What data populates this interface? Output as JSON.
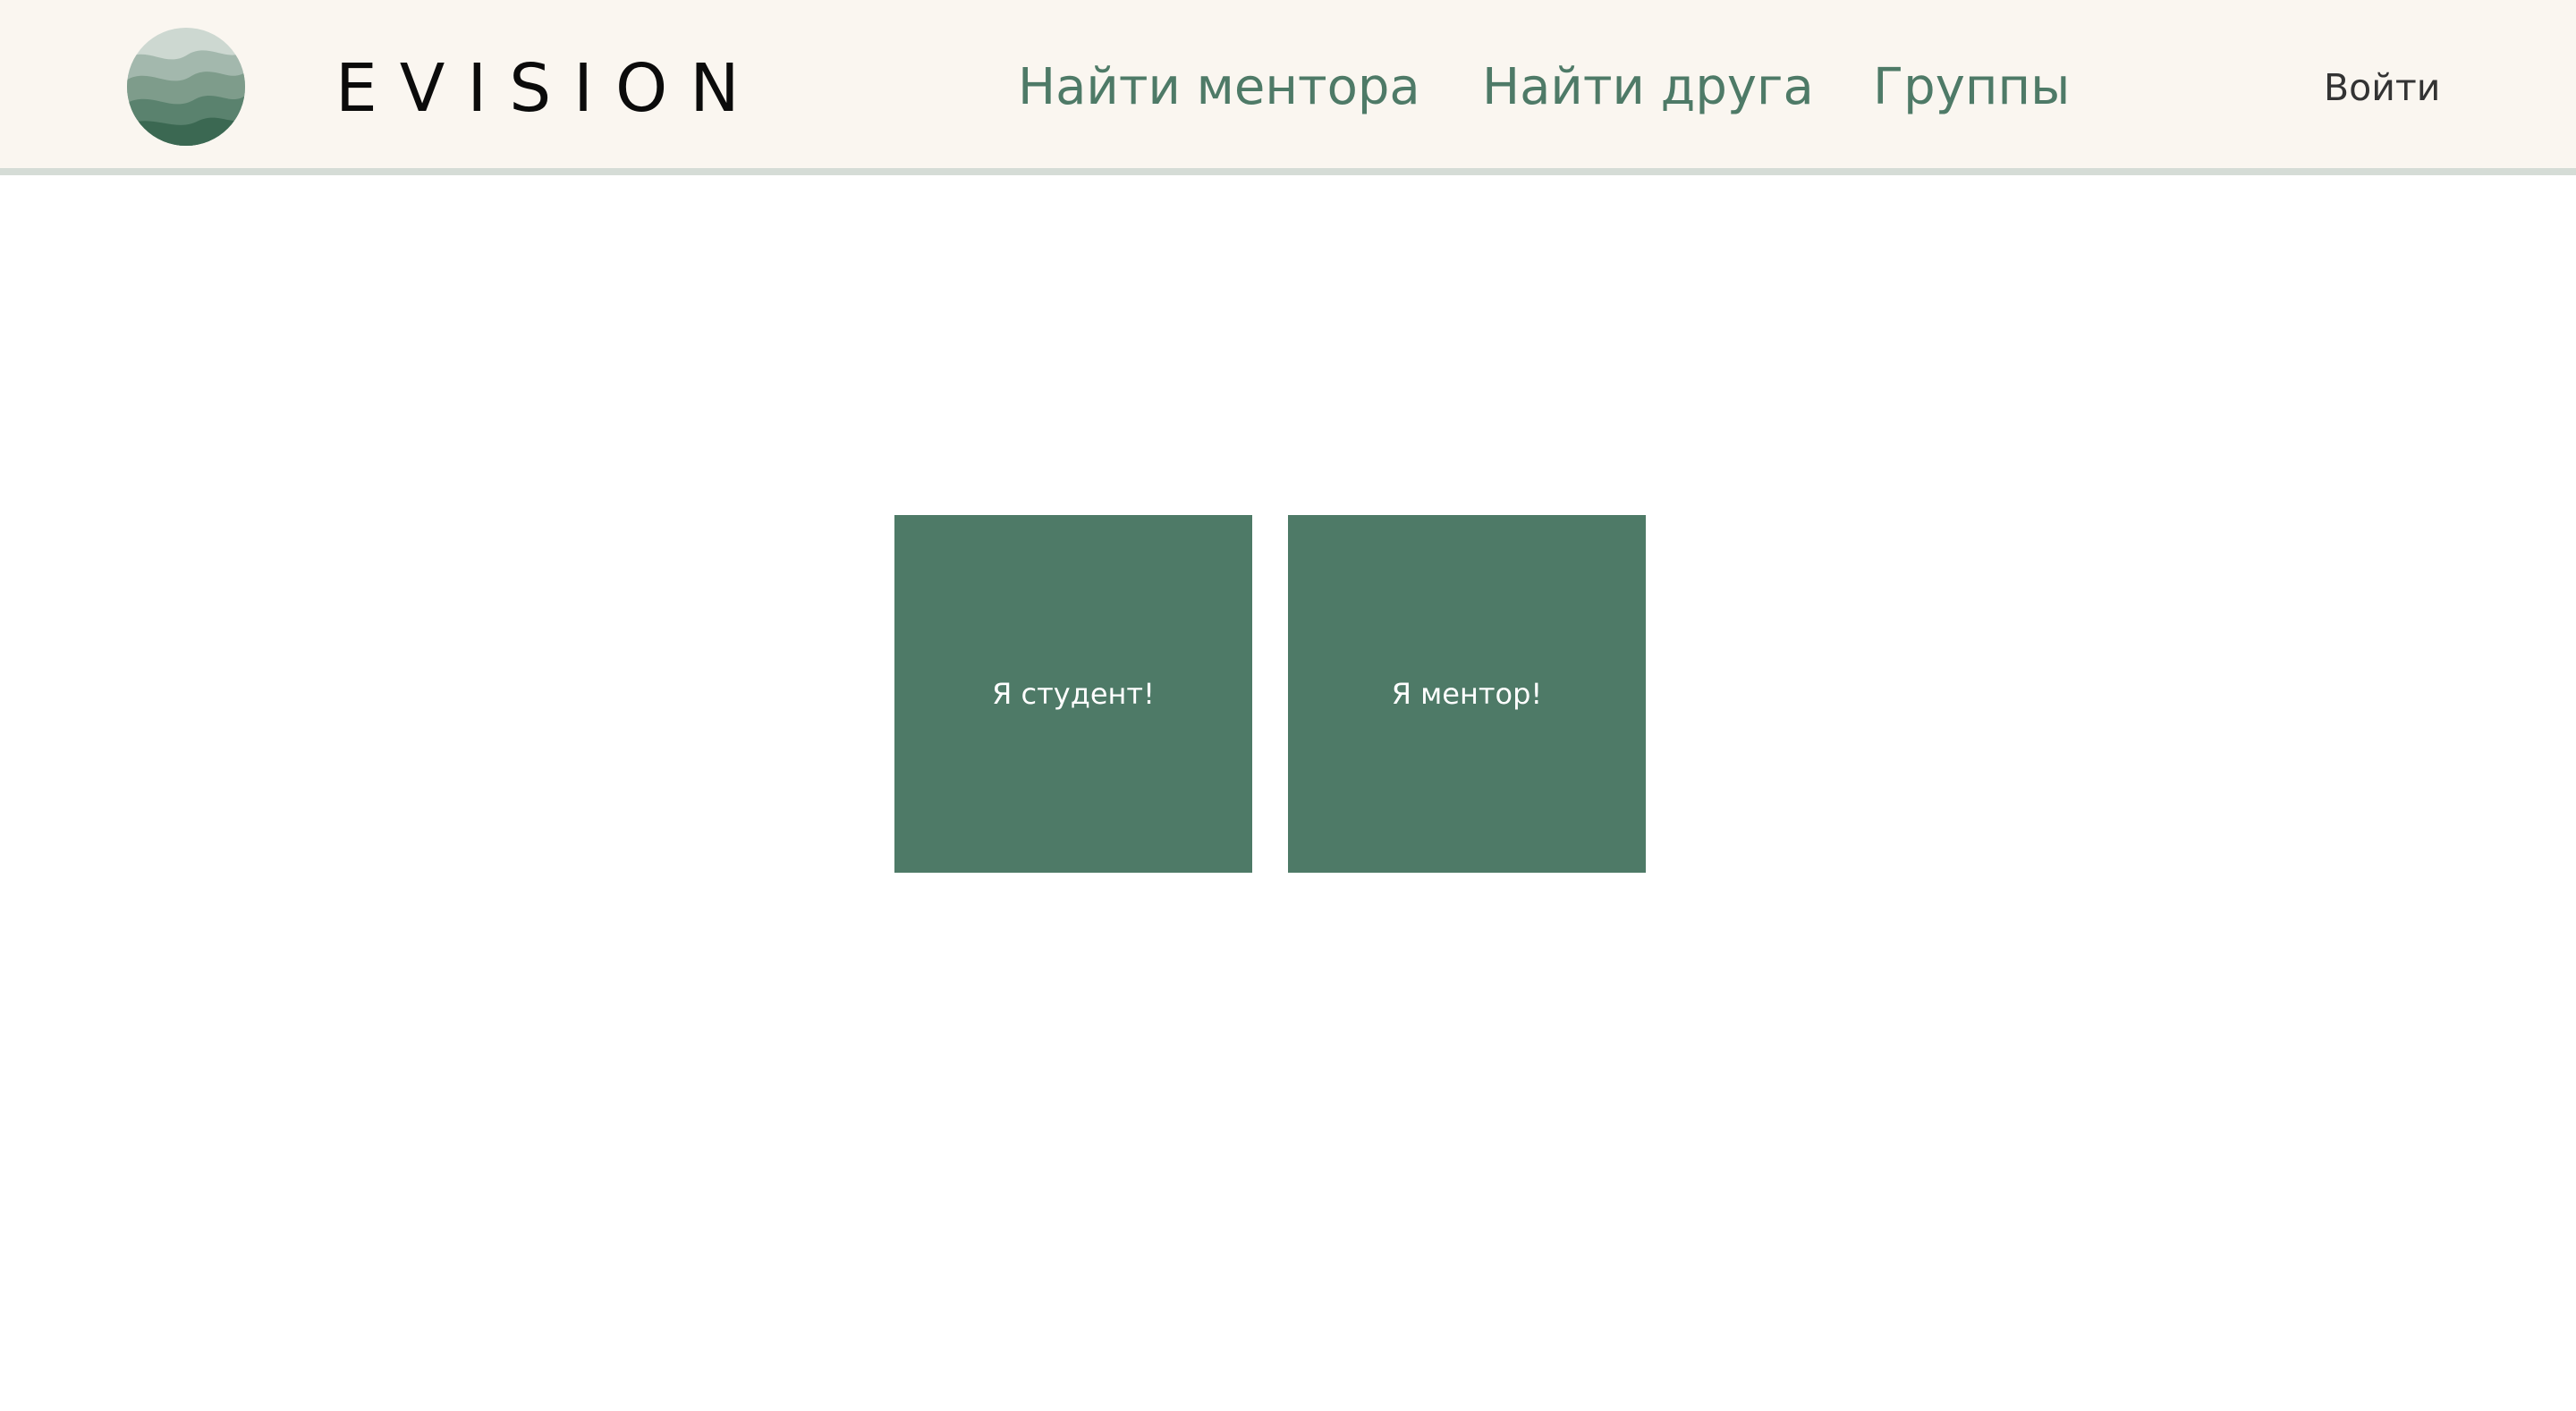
{
  "header": {
    "brand": "EVISION",
    "logo_icon": "waves-logo-icon",
    "nav": {
      "find_mentor": "Найти ментора",
      "find_friend": "Найти друга",
      "groups": "Группы"
    },
    "login": "Войти"
  },
  "main": {
    "cards": {
      "student": "Я студент!",
      "mentor": "Я ментор!"
    }
  },
  "colors": {
    "header_bg": "#faf6f0",
    "accent_green": "#4e7a67",
    "header_border": "#d5dcd6",
    "brand_text": "#0b0b0b",
    "login_text": "#333333"
  }
}
